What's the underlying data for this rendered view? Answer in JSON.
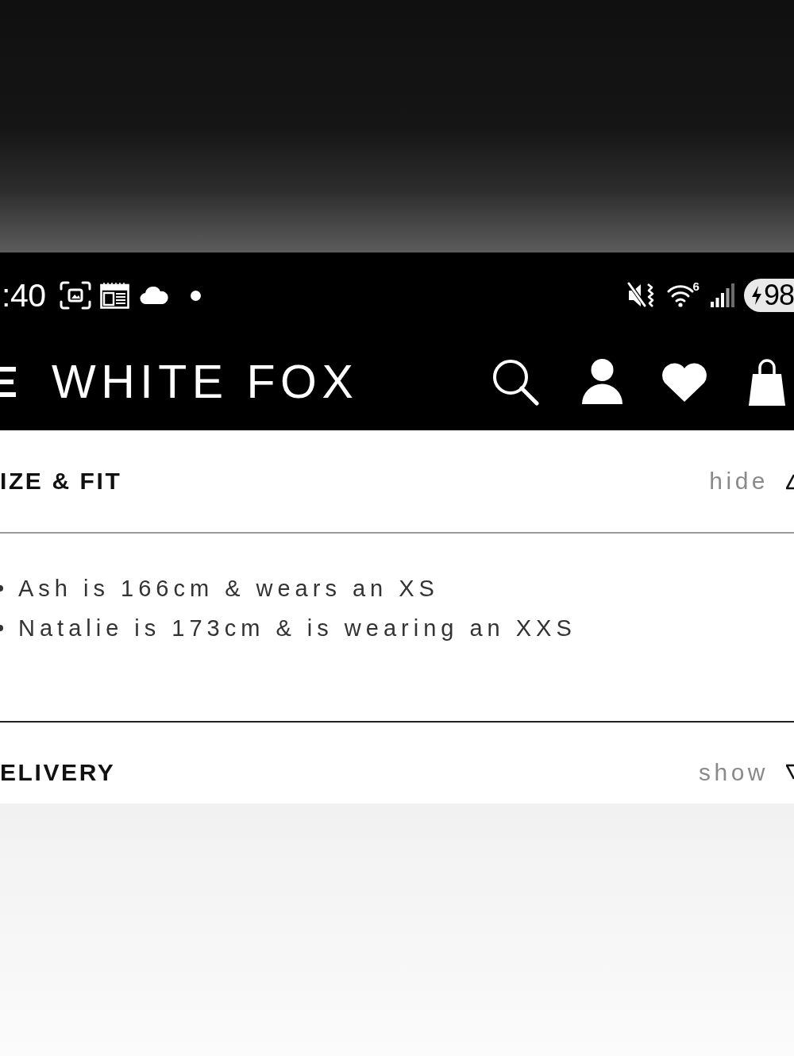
{
  "status_bar": {
    "time": ":40",
    "wifi_label": "6",
    "battery": "98"
  },
  "header": {
    "logo": "WHITE FOX"
  },
  "sections": [
    {
      "title": "IZE & FIT",
      "toggle": "hide",
      "expanded": true,
      "bullets": [
        "Ash is 166cm & wears an XS",
        "Natalie is 173cm & is wearing an XXS"
      ]
    },
    {
      "title": "ELIVERY",
      "toggle": "show",
      "expanded": false
    }
  ]
}
